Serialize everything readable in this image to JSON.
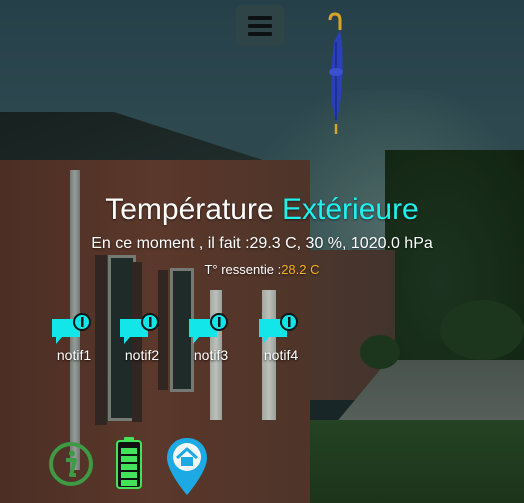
{
  "header": {
    "menu_icon": "hamburger-menu-icon",
    "weather_icon": "closed-umbrella-icon"
  },
  "weather": {
    "title_prefix": "Température",
    "title_accent": "Extérieure",
    "current_text": "En ce moment , il fait :29.3 C, 30 %, 1020.0 hPa",
    "feel_label": "T° ressentie :",
    "feel_value": "28.2 C"
  },
  "notifications": [
    {
      "label": "notif1",
      "icon": "notification-chat-icon"
    },
    {
      "label": "notif2",
      "icon": "notification-chat-icon"
    },
    {
      "label": "notif3",
      "icon": "notification-chat-icon"
    },
    {
      "label": "notif4",
      "icon": "notification-chat-icon"
    }
  ],
  "bottom_bar": {
    "info_icon": "info-icon",
    "battery_icon": "battery-full-icon",
    "battery_level": 1.0,
    "home_icon": "home-location-pin-icon"
  },
  "colors": {
    "accent": "#20f0ee",
    "feel_value": "#f5b21a",
    "notif_icon": "#13e6e8",
    "info_icon": "#3f9a45",
    "battery": "#45e35a",
    "home_pin": "#1da9e3"
  }
}
